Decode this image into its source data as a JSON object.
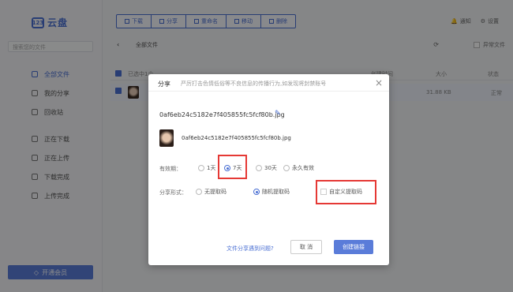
{
  "app": {
    "logo_mark": "123",
    "logo_text": "云盘"
  },
  "sidebar": {
    "search_placeholder": "搜索您的文件",
    "items": [
      {
        "label": "全部文件",
        "icon": "folder-icon"
      },
      {
        "label": "我的分享",
        "icon": "share-icon"
      },
      {
        "label": "回收站",
        "icon": "trash-icon"
      },
      {
        "label": "正在下载",
        "icon": "download-icon"
      },
      {
        "label": "正在上传",
        "icon": "upload-icon"
      },
      {
        "label": "下载完成",
        "icon": "check-circle-icon"
      },
      {
        "label": "上传完成",
        "icon": "check-circle-icon"
      }
    ],
    "vip_label": "开通会员"
  },
  "toolbar": {
    "buttons": [
      "下载",
      "分享",
      "重命名",
      "移动",
      "删除"
    ],
    "notify": "通知",
    "settings": "设置"
  },
  "main": {
    "breadcrumb": "全部文件",
    "abnormal_files": "异常文件",
    "header": {
      "selected": "已选中1个",
      "time": "创建时间",
      "size": "大小",
      "status": "状态"
    },
    "row": {
      "size": "31.88 KB",
      "status": "正常"
    }
  },
  "dialog": {
    "title": "分享",
    "warning": "严厉打击色情低俗等不良信息的传播行为,如发现将封禁账号",
    "filename": "0af6eb24c5182e7f405855fc5fcf80b.jpg",
    "file_item_name": "0af6eb24c5182e7f405855fc5fcf80b.jpg",
    "validity_label": "有效期：",
    "validity_options": [
      "1天",
      "7天",
      "30天",
      "永久有效"
    ],
    "validity_selected": "7天",
    "share_form_label": "分享形式：",
    "share_forms": [
      "无提取码",
      "随机提取码",
      "自定义提取码"
    ],
    "share_form_selected": "随机提取码",
    "help_link": "文件分享遇到问题?",
    "cancel": "取 消",
    "confirm": "创建链接"
  }
}
